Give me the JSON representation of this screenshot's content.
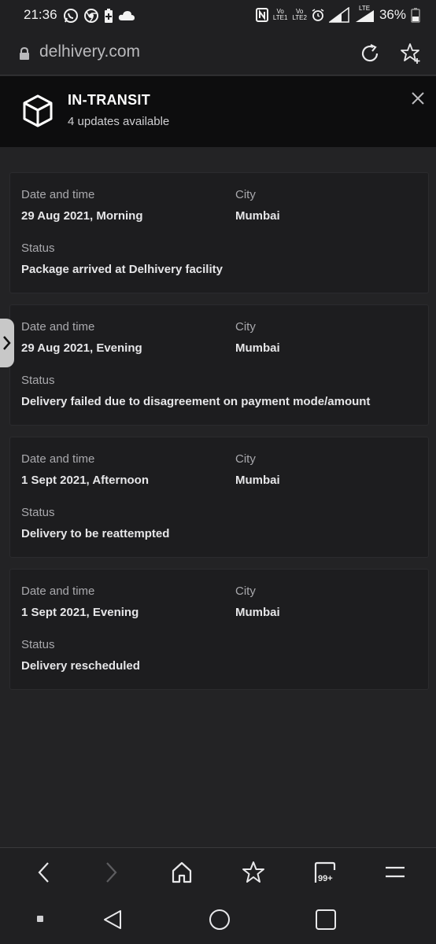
{
  "status_bar": {
    "time": "21:36",
    "sim1_top": "Vo",
    "sim1_bottom": "LTE1",
    "sim2_top": "Vo",
    "sim2_bottom": "LTE2",
    "network": "LTE",
    "battery": "36%",
    "icons": [
      "whatsapp-icon",
      "chrome-icon",
      "battery-saver-icon",
      "cloud-icon",
      "nfc-icon",
      "alarm-icon",
      "signal-icon"
    ]
  },
  "address_bar": {
    "url": "delhivery.com",
    "icons": [
      "lock-icon",
      "reload-icon",
      "add-bookmark-icon"
    ]
  },
  "notification": {
    "title": "IN-TRANSIT",
    "subtitle": "4 updates available",
    "icons": [
      "package-icon",
      "close-icon"
    ]
  },
  "labels": {
    "date_time": "Date and time",
    "city": "City",
    "status": "Status"
  },
  "updates": [
    {
      "date_time": "29 Aug 2021, Morning",
      "city": "Mumbai",
      "status": "Package arrived at Delhivery facility"
    },
    {
      "date_time": "29 Aug 2021, Evening",
      "city": "Mumbai",
      "status": "Delivery failed due to disagreement on payment mode/amount"
    },
    {
      "date_time": "1 Sept 2021, Afternoon",
      "city": "Mumbai",
      "status": "Delivery to be reattempted"
    },
    {
      "date_time": "1 Sept 2021, Evening",
      "city": "Mumbai",
      "status": "Delivery rescheduled"
    }
  ],
  "toolbar": {
    "tabs_count": "99+",
    "icons": [
      "back-icon",
      "forward-icon",
      "home-icon",
      "bookmark-star-icon",
      "tabs-icon",
      "menu-icon"
    ]
  },
  "navbar": {
    "icons": [
      "recents-dot-icon",
      "nav-back-icon",
      "nav-home-icon",
      "nav-overview-icon"
    ]
  }
}
